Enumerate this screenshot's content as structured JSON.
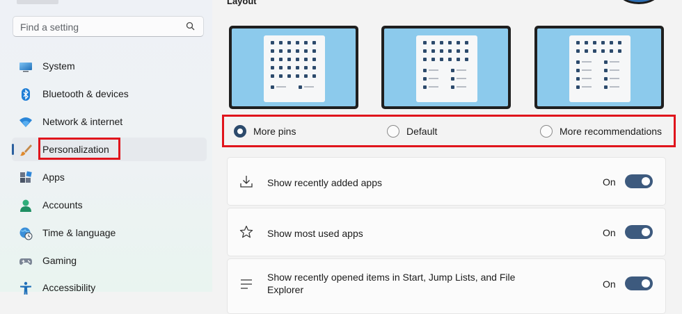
{
  "sidebar": {
    "search_placeholder": "Find a setting",
    "items": [
      {
        "label": "System",
        "icon": "monitor-icon"
      },
      {
        "label": "Bluetooth & devices",
        "icon": "bluetooth-icon"
      },
      {
        "label": "Network & internet",
        "icon": "wifi-icon"
      },
      {
        "label": "Personalization",
        "icon": "paintbrush-icon",
        "selected": true
      },
      {
        "label": "Apps",
        "icon": "apps-icon"
      },
      {
        "label": "Accounts",
        "icon": "person-icon"
      },
      {
        "label": "Time & language",
        "icon": "globe-clock-icon"
      },
      {
        "label": "Gaming",
        "icon": "gamepad-icon"
      },
      {
        "label": "Accessibility",
        "icon": "accessibility-icon"
      }
    ]
  },
  "main": {
    "section_title": "Layout",
    "layout_options": [
      {
        "label": "More pins",
        "checked": true
      },
      {
        "label": "Default",
        "checked": false
      },
      {
        "label": "More recommendations",
        "checked": false
      }
    ],
    "settings": [
      {
        "label": "Show recently added apps",
        "state": "On",
        "icon": "download-icon"
      },
      {
        "label": "Show most used apps",
        "state": "On",
        "icon": "star-icon"
      },
      {
        "label": "Show recently opened items in Start, Jump Lists, and File Explorer",
        "state": "On",
        "icon": "list-icon"
      }
    ]
  },
  "colors": {
    "highlight": "#e0141c",
    "accent": "#3d5a7e",
    "preview_sky": "#8ccaec"
  }
}
